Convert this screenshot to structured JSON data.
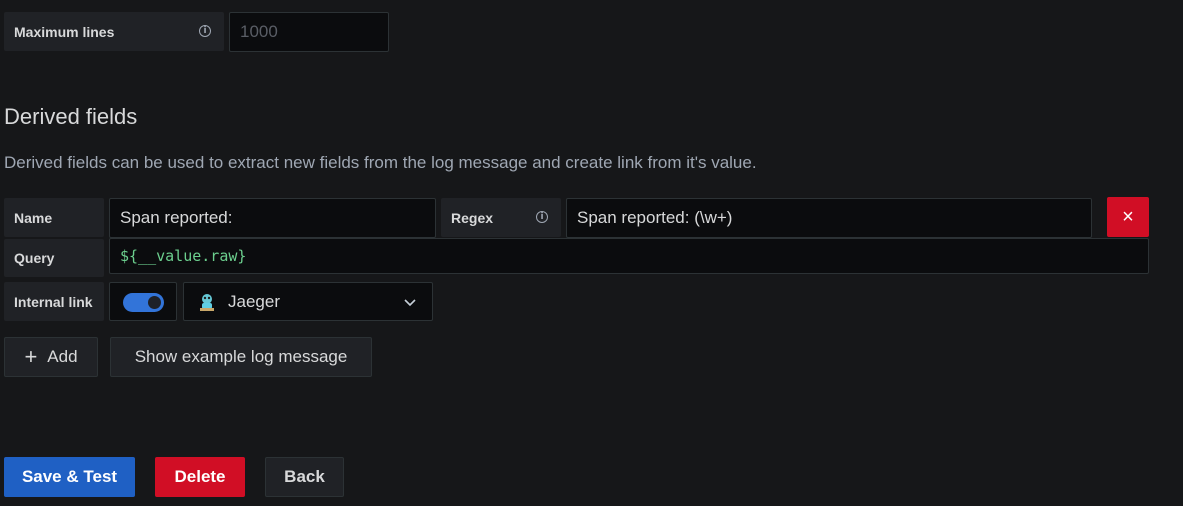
{
  "max_lines": {
    "label": "Maximum lines",
    "placeholder": "1000",
    "info_icon": "info-icon"
  },
  "derived": {
    "title": "Derived fields",
    "description": "Derived fields can be used to extract new fields from the log message and create link from it's value.",
    "name_label": "Name",
    "name_value": "Span reported:",
    "regex_label": "Regex",
    "regex_value": "Span reported: (\\w+)",
    "remove_icon": "×",
    "query_label": "Query",
    "query_value": "${__value.raw}",
    "internal_link_label": "Internal link",
    "internal_link_enabled": true,
    "datasource": "Jaeger",
    "add_icon": "+",
    "add_label": "Add",
    "show_example_label": "Show example log message"
  },
  "footer": {
    "save_label": "Save & Test",
    "delete_label": "Delete",
    "back_label": "Back"
  },
  "colors": {
    "primary": "#1f60c4",
    "danger": "#d10e25",
    "query_text": "#6ccf8e",
    "toggle": "#3274d9"
  }
}
